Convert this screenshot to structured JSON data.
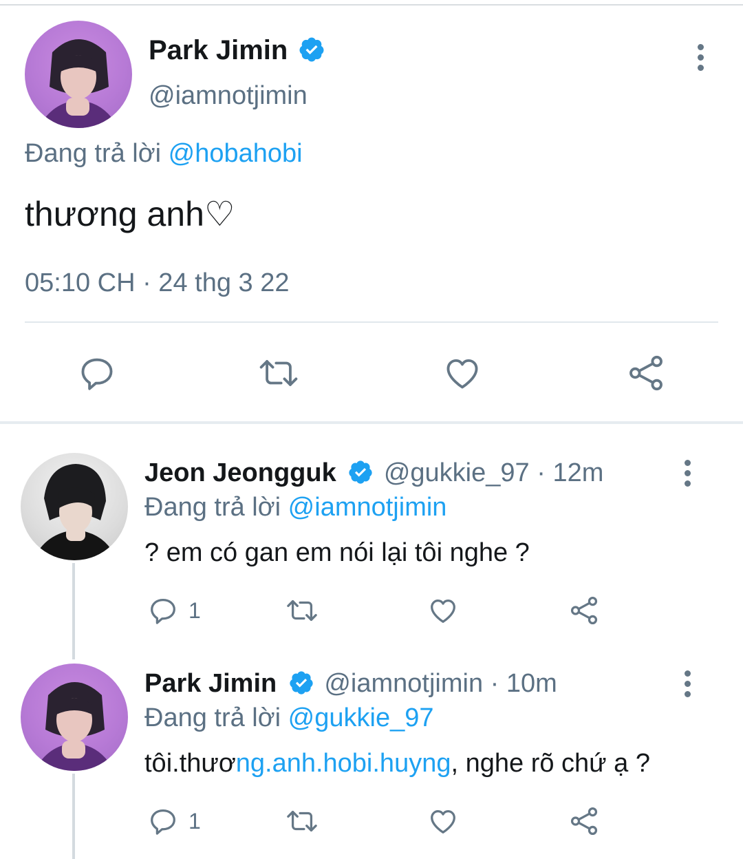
{
  "main_tweet": {
    "name": "Park Jimin",
    "handle": "@iamnotjimin",
    "replying_prefix": "Đang trả lời",
    "replying_to": "@hobahobi",
    "text": "thương anh♡",
    "timestamp": "05:10 CH · 24 thg 3 22"
  },
  "replies": [
    {
      "name": "Jeon Jeongguk",
      "handle": "@gukkie_97",
      "sep": "·",
      "time": "12m",
      "replying_prefix": "Đang trả lời",
      "replying_to": "@iamnotjimin",
      "text": "? em có gan em nói lại tôi nghe ?",
      "reply_count": "1"
    },
    {
      "name": "Park Jimin",
      "handle": "@iamnotjimin",
      "sep": "·",
      "time": "10m",
      "replying_prefix": "Đang trả lời",
      "replying_to": "@gukkie_97",
      "text_plain_start": "tôi.thươ",
      "text_link": "ng.anh.hobi.huyng",
      "text_plain_end": ", nghe rõ chứ ạ ?",
      "reply_count": "1"
    }
  ],
  "colors": {
    "accent": "#1da1f2",
    "muted": "#5b7083",
    "icon": "#657786"
  },
  "icons": [
    "verified-badge-icon",
    "more-icon",
    "reply-icon",
    "retweet-icon",
    "like-icon",
    "share-icon"
  ]
}
